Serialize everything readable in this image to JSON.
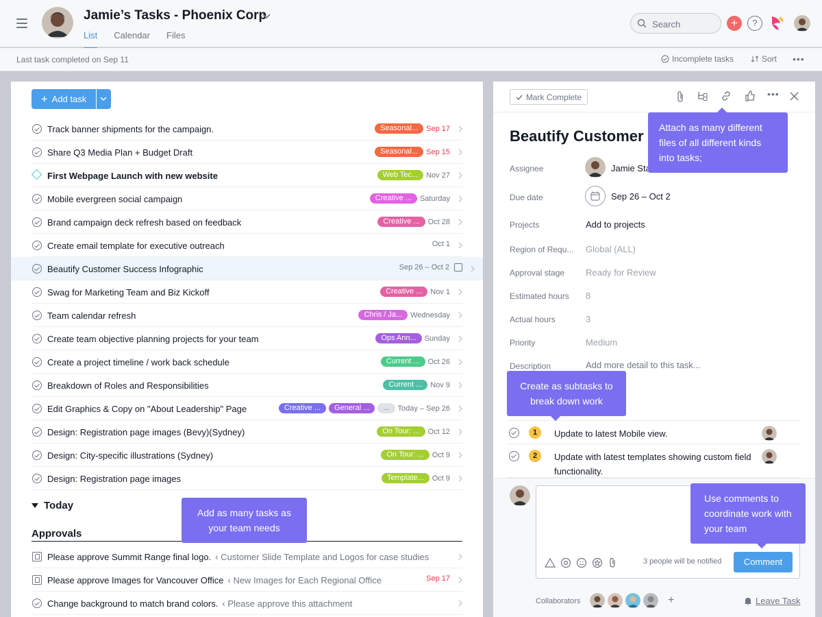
{
  "header": {
    "title": "Jamie’s Tasks - Phoenix Corp",
    "tabs": [
      "List",
      "Calendar",
      "Files"
    ],
    "search_placeholder": "Search"
  },
  "subheader": {
    "last_completed": "Last task completed on Sep 11",
    "incomplete": "Incomplete tasks",
    "sort": "Sort"
  },
  "list": {
    "add_task": "Add task",
    "tasks": [
      {
        "name": "Track banner shipments for the campaign.",
        "tags": [
          {
            "label": "Seasonal...",
            "color": "#f06a43"
          }
        ],
        "date": "Sep 17",
        "date_red": true,
        "icon": "check"
      },
      {
        "name": "Share Q3 Media Plan + Budget Draft",
        "tags": [
          {
            "label": "Seasonal...",
            "color": "#f06a43"
          }
        ],
        "date": "Sep 15",
        "date_red": true,
        "icon": "check"
      },
      {
        "name": "First Webpage Launch with new website",
        "tags": [
          {
            "label": "Web Tec...",
            "color": "#a4cf30"
          }
        ],
        "date": "Nov 27",
        "date_red": false,
        "icon": "milestone",
        "bold": true
      },
      {
        "name": "Mobile evergreen social campaign",
        "tags": [
          {
            "label": "Creative ...",
            "color": "#e362e3"
          }
        ],
        "date": "Saturday",
        "date_red": false,
        "icon": "check"
      },
      {
        "name": "Brand campaign deck refresh based on feedback",
        "tags": [
          {
            "label": "Creative ...",
            "color": "#e362a3"
          }
        ],
        "date": "Oct 28",
        "date_red": false,
        "icon": "check"
      },
      {
        "name": "Create email template for executive outreach",
        "tags": [],
        "date": "Oct 1",
        "date_red": false,
        "icon": "check"
      },
      {
        "name": "Beautify Customer Success Infographic",
        "tags": [],
        "date": "Sep 26 – Oct 2",
        "date_red": false,
        "icon": "check",
        "selected": true
      },
      {
        "name": "Swag for Marketing Team and Biz Kickoff",
        "tags": [
          {
            "label": "Creative ...",
            "color": "#e362a3"
          }
        ],
        "date": "Nov 1",
        "date_red": false,
        "icon": "check"
      },
      {
        "name": "Team calendar refresh",
        "tags": [
          {
            "label": "Chris / Ja...",
            "color": "#d56ae0"
          }
        ],
        "date": "Wednesday",
        "date_red": false,
        "icon": "check"
      },
      {
        "name": "Create team objective planning projects for your team",
        "tags": [
          {
            "label": "Ops Ann...",
            "color": "#a45ee0"
          }
        ],
        "date": "Sunday",
        "date_red": false,
        "icon": "check"
      },
      {
        "name": "Create a project timeline / work back schedule",
        "tags": [
          {
            "label": "Current ...",
            "color": "#4ecb8b"
          }
        ],
        "date": "Oct 26",
        "date_red": false,
        "icon": "check"
      },
      {
        "name": "Breakdown of Roles and Responsibilities",
        "tags": [
          {
            "label": "Current ...",
            "color": "#4ebfa5"
          }
        ],
        "date": "Nov 9",
        "date_red": false,
        "icon": "check"
      },
      {
        "name": "Edit Graphics & Copy on \"About Leadership\" Page",
        "tags": [
          {
            "label": "Creative ...",
            "color": "#7a6ff0"
          },
          {
            "label": "General ...",
            "color": "#a45ee0"
          },
          {
            "label": "...",
            "color": "#e0e3e6"
          }
        ],
        "date": "Today – Sep 26",
        "date_red": false,
        "icon": "check"
      },
      {
        "name": "Design: Registration page images (Bevy)(Sydney)",
        "tags": [
          {
            "label": "On Tour: ...",
            "color": "#a4cf30"
          }
        ],
        "date": "Oct 12",
        "date_red": false,
        "icon": "check"
      },
      {
        "name": "Design: City-specific illustrations (Sydney)",
        "tags": [
          {
            "label": "On Tour: ...",
            "color": "#a4cf30"
          }
        ],
        "date": "Oct 9",
        "date_red": false,
        "icon": "check"
      },
      {
        "name": "Design: Registration page images",
        "tags": [
          {
            "label": "Template...",
            "color": "#a4cf30"
          }
        ],
        "date": "Oct 9",
        "date_red": false,
        "icon": "check"
      }
    ],
    "section_today": "Today",
    "section_approvals": "Approvals",
    "approvals": [
      {
        "name": "Please approve Summit Range final logo.",
        "context": "‹ Customer Slide Template and Logos for case studies",
        "date": "",
        "icon": "approval"
      },
      {
        "name": "Please approve Images for Vancouver Office",
        "context": "‹ New Images for Each Regional Office",
        "date": "Sep 17",
        "icon": "approval"
      },
      {
        "name": "Change background to match brand colors.",
        "context": "‹ Please approve this attachment",
        "date": "",
        "icon": "check"
      }
    ]
  },
  "detail": {
    "mark_complete": "Mark Complete",
    "title": "Beautify Customer S",
    "fields": {
      "assignee_label": "Assignee",
      "assignee_value": "Jamie Sta",
      "due_label": "Due date",
      "due_value": "Sep 26 – Oct 2",
      "projects_label": "Projects",
      "projects_value": "Add to projects",
      "region_label": "Region of Requ...",
      "region_value": "Global (ALL)",
      "approval_label": "Approval stage",
      "approval_value": "Ready for Review",
      "est_label": "Estimated hours",
      "est_value": "8",
      "actual_label": "Actual hours",
      "actual_value": "3",
      "priority_label": "Priority",
      "priority_value": "Medium",
      "desc_label": "Description",
      "desc_value": "Add more detail to this task..."
    },
    "subtasks": [
      {
        "num": "1",
        "text": "Update to latest Mobile view."
      },
      {
        "num": "2",
        "text": "Update with latest templates showing custom field functionality."
      }
    ],
    "notify": "3 people will be notified",
    "comment_button": "Comment",
    "collaborators_label": "Collaborators",
    "leave_task": "Leave Task"
  },
  "tooltips": {
    "attach": "Attach as many different files of all different kinds into tasks;",
    "subtasks": "Create as subtasks to break down work",
    "add_tasks": "Add as many tasks as your team needs",
    "comments": "Use comments to coordinate work with your team"
  },
  "colors": {
    "accent": "#4a9eea",
    "tooltip": "#7a6ff0",
    "danger": "#e8384f"
  }
}
